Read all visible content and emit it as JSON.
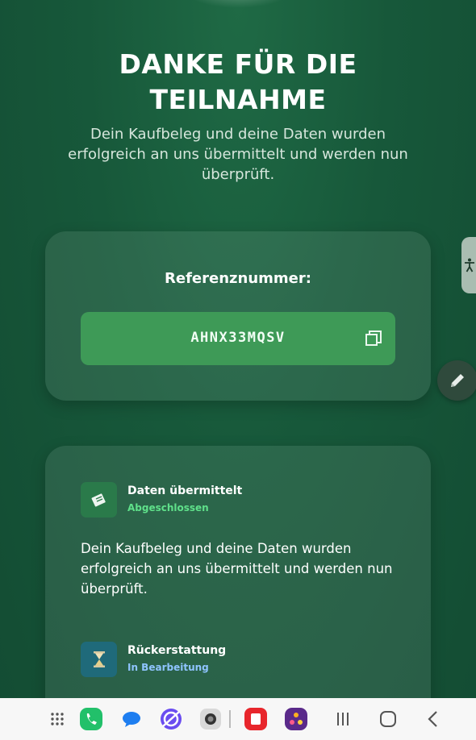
{
  "header": {
    "title_line1": "DANKE FÜR DIE",
    "title_line2": "TEILNAHME",
    "subtitle": "Dein Kaufbeleg und deine Daten wurden erfolgreich an uns übermittelt und werden nun überprüft."
  },
  "reference": {
    "label": "Referenznummer:",
    "code": "AHNX33MQSV"
  },
  "steps": [
    {
      "title": "Daten übermittelt",
      "state": "Abgeschlossen",
      "state_color": "#5fe08a",
      "description": "Dein Kaufbeleg und deine Daten wurden erfolgreich an uns übermittelt und werden nun überprüft.",
      "icon": "receipt-icon"
    },
    {
      "title": "Rückerstattung",
      "state": "In Bearbeitung",
      "state_color": "#8fc4ff",
      "icon": "hourglass-icon"
    }
  ],
  "colors": {
    "background": "#17583a",
    "accent_green": "#3e9a57"
  },
  "navbar_icons": [
    "apps-icon",
    "phone-icon",
    "messages-icon",
    "browser-icon",
    "camera-icon",
    "store-icon",
    "game-icon",
    "recents-icon",
    "home-icon",
    "back-icon"
  ]
}
